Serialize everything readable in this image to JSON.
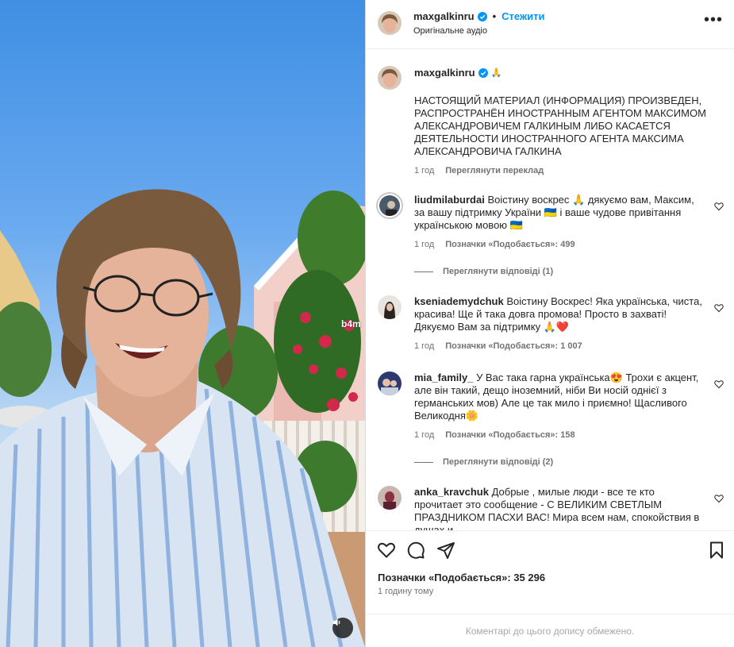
{
  "media": {
    "watermark": "b4m"
  },
  "header": {
    "username": "maxgalkinru",
    "follow_label": "Стежити",
    "subtitle": "Оригінальне аудіо"
  },
  "caption": {
    "username": "maxgalkinru",
    "text": "НАСТОЯЩИЙ МАТЕРИАЛ (ИНФОРМАЦИЯ) ПРОИЗВЕДЕН, РАСПРОСТРАНЁН ИНОСТРАННЫМ АГЕНТОМ МАКСИМОМ АЛЕКСАНДРОВИЧЕМ ГАЛКИНЫМ ЛИБО КАСАЕТСЯ ДЕЯТЕЛЬНОСТИ ИНОСТРАННОГО АГЕНТА МАКСИМА АЛЕКСАНДРОВИЧА ГАЛКИНА",
    "age": "1 год",
    "translate": "Переглянути переклад"
  },
  "comments": [
    {
      "username": "liudmilaburdai",
      "text": "Воістину воскрес 🙏 дякуємо вам, Максим, за вашу підтримку України 🇺🇦 і ваше чудове привітання українською мовою 🇺🇦",
      "age": "1 год",
      "likes": "Позначки «Подобається»: 499",
      "replies": "Переглянути відповіді (1)"
    },
    {
      "username": "kseniademydchuk",
      "text": "Воістину Воскрес! Яка українська, чиста, красива! Ще й така довга промова! Просто в захваті! Дякуємо Вам за підтримку 🙏❤️",
      "age": "1 год",
      "likes": "Позначки «Подобається»: 1 007"
    },
    {
      "username": "mia_family_",
      "text": "У Вас така гарна українська😍 Трохи є акцент, але він такий, дещо іноземний, ніби Ви носій однієї з германських мов) Але це так мило і приємно! Щасливого Великодня🌼",
      "age": "1 год",
      "likes": "Позначки «Подобається»: 158",
      "replies": "Переглянути відповіді (2)"
    },
    {
      "username": "anka_kravchuk",
      "text": "Добрые , милые люди - все те кто прочитает это сообщение - С ВЕЛИКИМ СВЕТЛЫМ ПРАЗДНИКОМ ПАСХИ ВАС! Мира всем нам, спокойствия в душах и"
    }
  ],
  "actions": {
    "likes": "Позначки «Подобається»: 35 296",
    "time": "1 годину тому"
  },
  "footer": {
    "text": "Коментарі до цього допису обмежено."
  },
  "colors": {
    "accent": "#0095f6",
    "muted": "#737373",
    "heart": "#e0245e"
  },
  "icons": [
    "verified-icon",
    "more-icon",
    "heart-icon",
    "comment-icon",
    "share-icon",
    "bookmark-icon",
    "audio-icon"
  ]
}
